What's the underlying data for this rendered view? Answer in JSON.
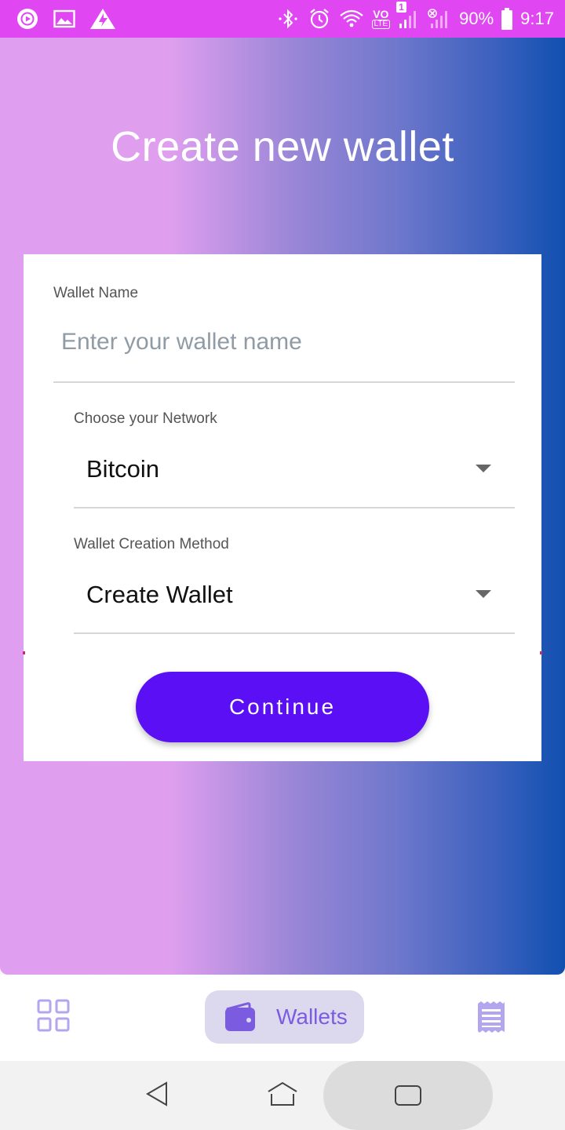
{
  "status_bar": {
    "battery": "90%",
    "time": "9:17",
    "sim_badge": "1",
    "volte": "VO",
    "lte": "LTE",
    "icons": [
      "play-icon",
      "image-icon",
      "alert-icon",
      "bluetooth-icon",
      "alarm-icon",
      "wifi-icon",
      "volte-icon",
      "signal-icon",
      "signal-off-icon",
      "battery-icon"
    ]
  },
  "page": {
    "title": "Create new wallet"
  },
  "form": {
    "wallet_name": {
      "label": "Wallet Name",
      "value": "",
      "placeholder": "Enter your wallet name"
    },
    "network": {
      "label": "Choose your Network",
      "selected": "Bitcoin"
    },
    "creation_method": {
      "label": "Wallet Creation Method",
      "selected": "Create Wallet"
    },
    "continue_label": "Continue"
  },
  "bottom_nav": {
    "items": [
      {
        "icon": "grid-icon",
        "label": ""
      },
      {
        "icon": "wallet-icon",
        "label": "Wallets",
        "active": true
      },
      {
        "icon": "receipt-icon",
        "label": ""
      }
    ]
  },
  "system_nav": {
    "icons": [
      "back-icon",
      "home-icon",
      "recents-icon"
    ]
  },
  "colors": {
    "status_bar": "#e046f2",
    "gradient_start": "#e09ef0",
    "gradient_end": "#1150b0",
    "primary_button": "#5b0ff4",
    "nav_active": "#7b5ce0",
    "nav_active_bg": "#dcd9ee"
  }
}
